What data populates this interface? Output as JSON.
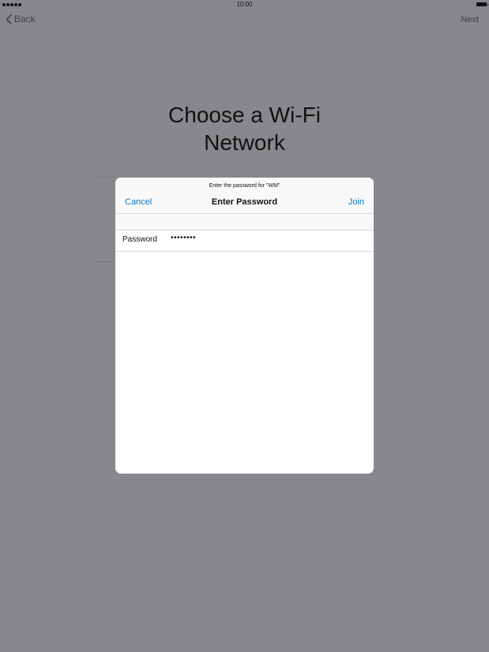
{
  "status_bar": {
    "time": "10:00"
  },
  "nav": {
    "back_label": "Back",
    "next_label": "Next"
  },
  "page": {
    "title": "Choose a Wi-Fi\nNetwork"
  },
  "dialog": {
    "prompt": "Enter the password for \"WM\"",
    "title": "Enter Password",
    "cancel_label": "Cancel",
    "join_label": "Join",
    "password_label": "Password",
    "password_value": "••••••••"
  },
  "colors": {
    "background": "#87888b",
    "accent": "#0a78ce",
    "dialog_background": "#ffffff"
  }
}
